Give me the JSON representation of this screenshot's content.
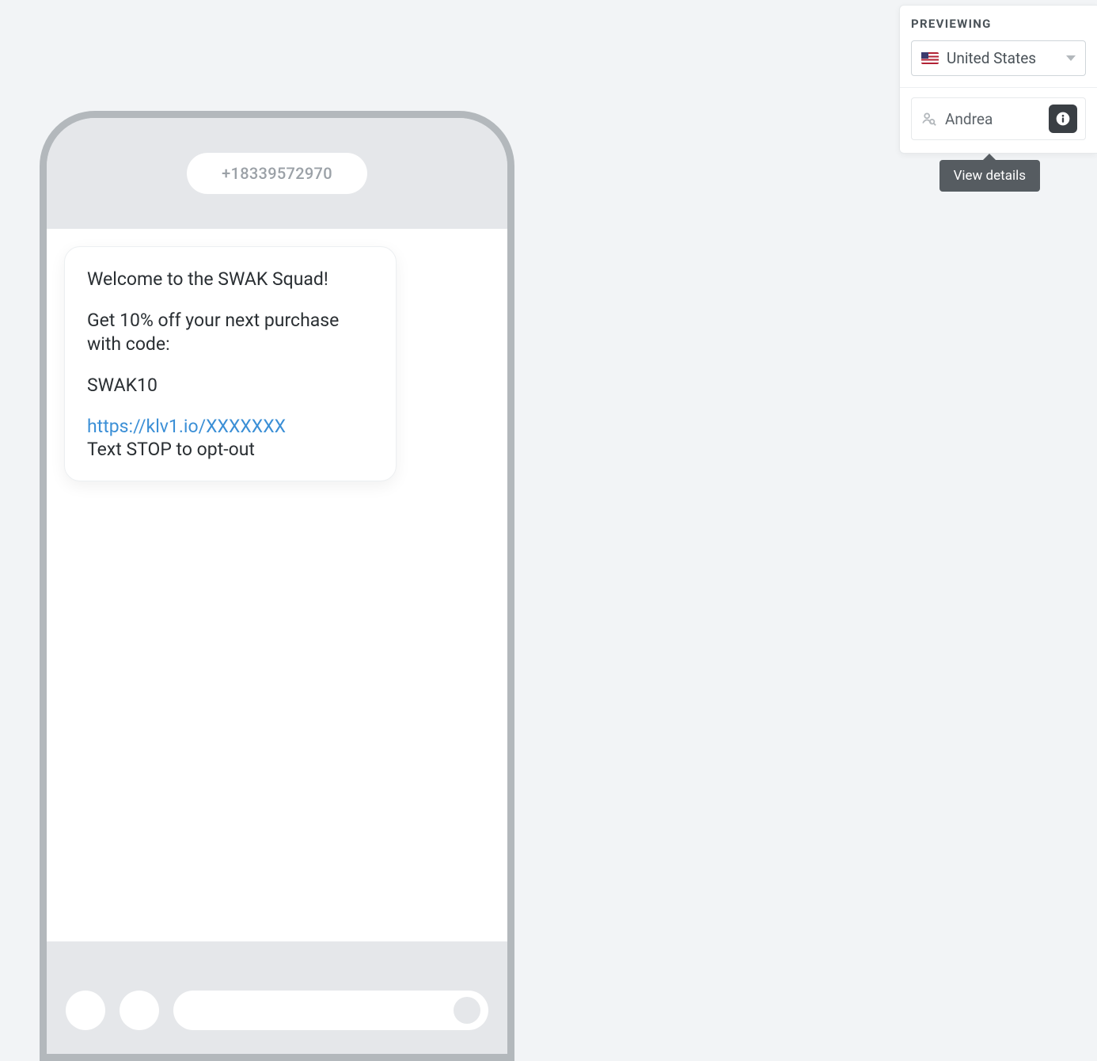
{
  "phone": {
    "number": "+18339572970",
    "message": {
      "greeting": "Welcome to the SWAK Squad!",
      "offer": "Get 10% off your next purchase with code:",
      "code": "SWAK10",
      "link": "https://klv1.io/XXXXXXX",
      "optout": "Text STOP to opt-out"
    }
  },
  "preview": {
    "title": "PREVIEWING",
    "country": "United States",
    "user": "Andrea",
    "tooltip": "View details"
  }
}
